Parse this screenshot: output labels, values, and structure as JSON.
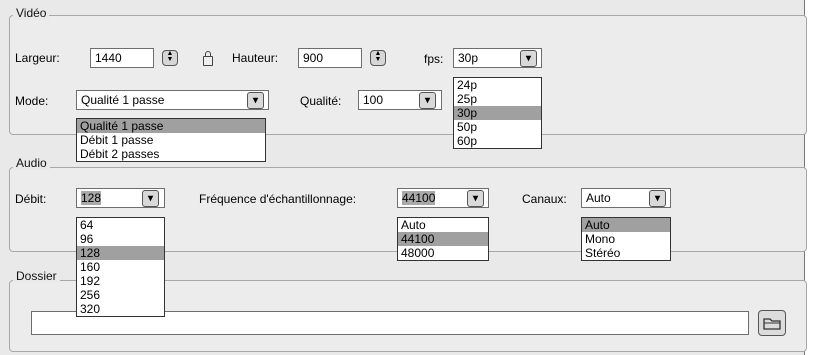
{
  "video": {
    "legend": "Vidéo",
    "width_label": "Largeur:",
    "width_value": "1440",
    "height_label": "Hauteur:",
    "height_value": "900",
    "fps_label": "fps:",
    "fps_value": "30p",
    "fps_options": [
      "24p",
      "25p",
      "30p",
      "50p",
      "60p"
    ],
    "fps_selected_index": 2,
    "mode_label": "Mode:",
    "mode_value": "Qualité 1 passe",
    "mode_options": [
      "Qualité 1 passe",
      "Débit 1 passe",
      "Débit 2 passes"
    ],
    "mode_selected_index": 0,
    "quality_label": "Qualité:",
    "quality_value": "100"
  },
  "audio": {
    "legend": "Audio",
    "bitrate_label": "Débit:",
    "bitrate_value": "128",
    "bitrate_options": [
      "64",
      "96",
      "128",
      "160",
      "192",
      "256",
      "320"
    ],
    "bitrate_selected_index": 2,
    "samplerate_label": "Fréquence d'échantillonnage:",
    "samplerate_value": "44100",
    "samplerate_options": [
      "Auto",
      "44100",
      "48000"
    ],
    "samplerate_selected_index": 1,
    "channels_label": "Canaux:",
    "channels_value": "Auto",
    "channels_options": [
      "Auto",
      "Mono",
      "Stéréo"
    ],
    "channels_selected_index": 0
  },
  "folder": {
    "legend": "Dossier",
    "path_value": ""
  },
  "icons": {
    "spinner": "spinner-arrows-icon",
    "lock": "lock-icon",
    "dropdown": "chevron-down-icon",
    "browse": "folder-icon"
  }
}
